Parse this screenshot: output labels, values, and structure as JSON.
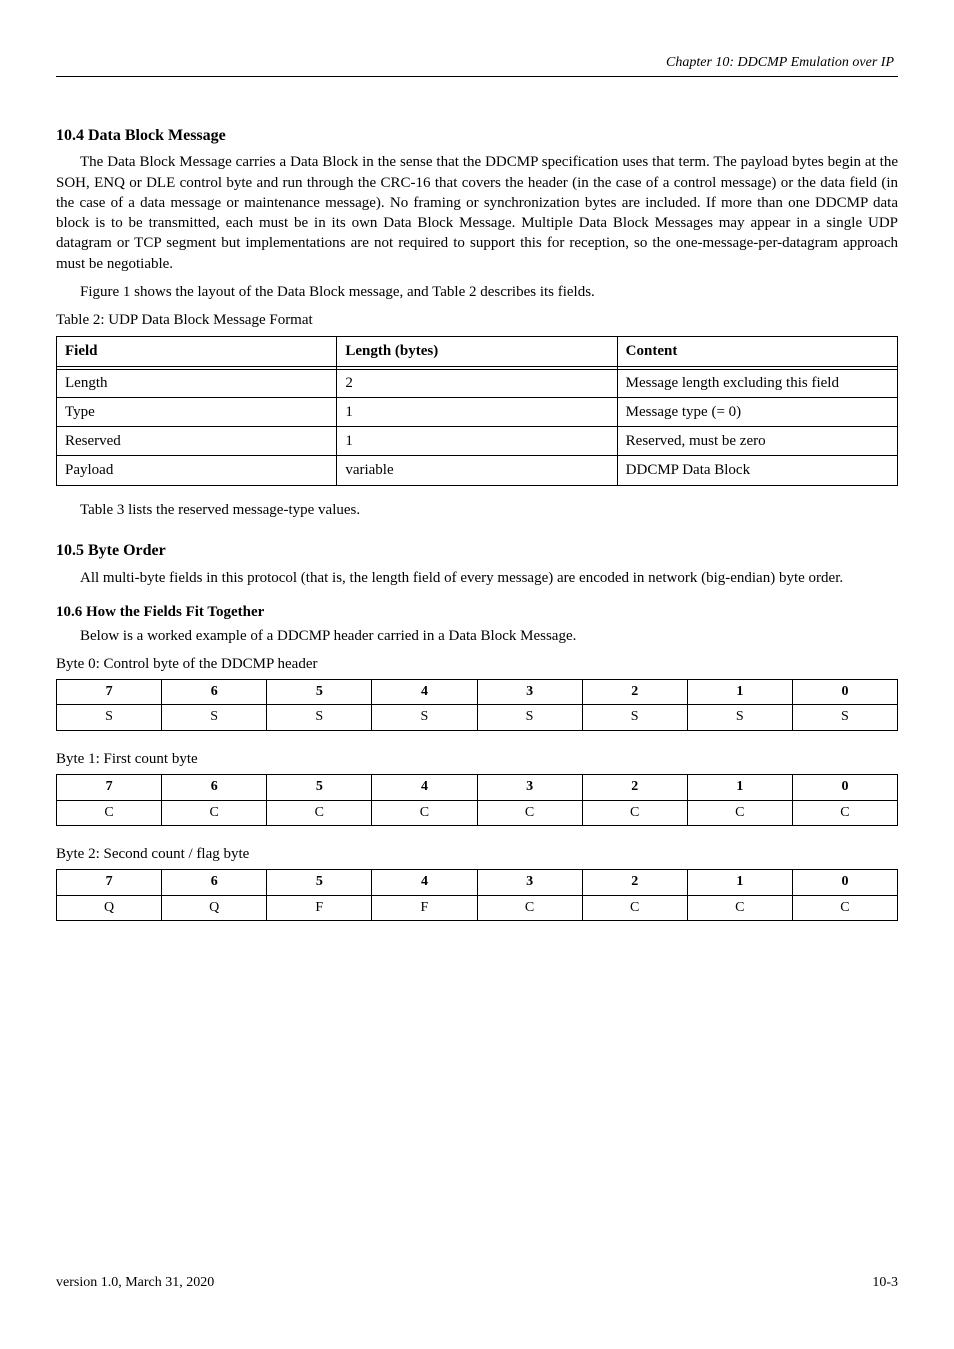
{
  "header": {
    "running_head_em": "Chapter 10: DDCMP Emulation over IP",
    "subtitle": "Data Block Message"
  },
  "section": {
    "num_title": "10.4 Data Block Message",
    "para1": "The Data Block Message carries a Data Block in the sense that the DDCMP specification uses that term. The payload bytes begin at the SOH, ENQ or DLE control byte and run through the CRC-16 that covers the header (in the case of a control message) or the data field (in the case of a data message or maintenance message). No framing or synchronization bytes are included. If more than one DDCMP data block is to be transmitted, each must be in its own Data Block Message. Multiple Data Block Messages may appear in a single UDP datagram or TCP segment but implementations are not required to support this for reception, so the one-message-per-datagram approach must be negotiable.",
    "para2_pre": "Figure 1 shows the layout of the Data Block message, and Table 2 describes its fields.",
    "para2_post": "Table 3 lists the reserved message-type values."
  },
  "table2": {
    "caption": "Table 2: UDP Data Block Message Format",
    "headers": [
      "Field",
      "Length (bytes)",
      "Content"
    ],
    "rows": [
      [
        "Length",
        "2",
        "Message length excluding this field"
      ],
      [
        "Type",
        "1",
        "Message type (= 0)"
      ],
      [
        "Reserved",
        "1",
        "Reserved, must be zero"
      ],
      [
        "Payload",
        "variable",
        "DDCMP Data Block"
      ]
    ]
  },
  "section2": {
    "num_title": "10.5 Byte Order",
    "para": "All multi-byte fields in this protocol (that is, the length field of every message) are encoded in network (big-endian) byte order.",
    "num_title2": "10.6 How the Fields Fit Together",
    "para_intro": "Below is a worked example of a DDCMP header carried in a Data Block Message.",
    "byte0_label": "Byte 0:",
    "byte0_sub": "Control byte of the DDCMP header",
    "byte1_label": "Byte 1:",
    "byte1_sub": "First count byte",
    "byte2_label": "Byte 2:",
    "byte2_sub": "Second count / flag byte"
  },
  "bit_tables": {
    "bitnums": [
      "7",
      "6",
      "5",
      "4",
      "3",
      "2",
      "1",
      "0"
    ],
    "byte0": [
      "S",
      "S",
      "S",
      "S",
      "S",
      "S",
      "S",
      "S"
    ],
    "byte1": [
      "C",
      "C",
      "C",
      "C",
      "C",
      "C",
      "C",
      "C"
    ],
    "byte2": [
      "Q",
      "Q",
      "F",
      "F",
      "C",
      "C",
      "C",
      "C"
    ]
  },
  "footer": {
    "left": "version 1.0, March 31, 2020",
    "right": "10-3"
  },
  "chart_data": [
    {
      "type": "table",
      "title": "Table 2: UDP Data Block Message Format",
      "columns": [
        "Field",
        "Length (bytes)",
        "Content"
      ],
      "rows": [
        [
          "Length",
          "2",
          "Message length excluding this field"
        ],
        [
          "Type",
          "1",
          "Message type (= 0)"
        ],
        [
          "Reserved",
          "1",
          "Reserved, must be zero"
        ],
        [
          "Payload",
          "variable",
          "DDCMP Data Block"
        ]
      ]
    },
    {
      "type": "table",
      "title": "Byte 0 bit layout",
      "columns": [
        "bit7",
        "bit6",
        "bit5",
        "bit4",
        "bit3",
        "bit2",
        "bit1",
        "bit0"
      ],
      "rows": [
        [
          "S",
          "S",
          "S",
          "S",
          "S",
          "S",
          "S",
          "S"
        ]
      ]
    },
    {
      "type": "table",
      "title": "Byte 1 bit layout",
      "columns": [
        "bit7",
        "bit6",
        "bit5",
        "bit4",
        "bit3",
        "bit2",
        "bit1",
        "bit0"
      ],
      "rows": [
        [
          "C",
          "C",
          "C",
          "C",
          "C",
          "C",
          "C",
          "C"
        ]
      ]
    },
    {
      "type": "table",
      "title": "Byte 2 bit layout",
      "columns": [
        "bit7",
        "bit6",
        "bit5",
        "bit4",
        "bit3",
        "bit2",
        "bit1",
        "bit0"
      ],
      "rows": [
        [
          "Q",
          "Q",
          "F",
          "F",
          "C",
          "C",
          "C",
          "C"
        ]
      ]
    }
  ]
}
